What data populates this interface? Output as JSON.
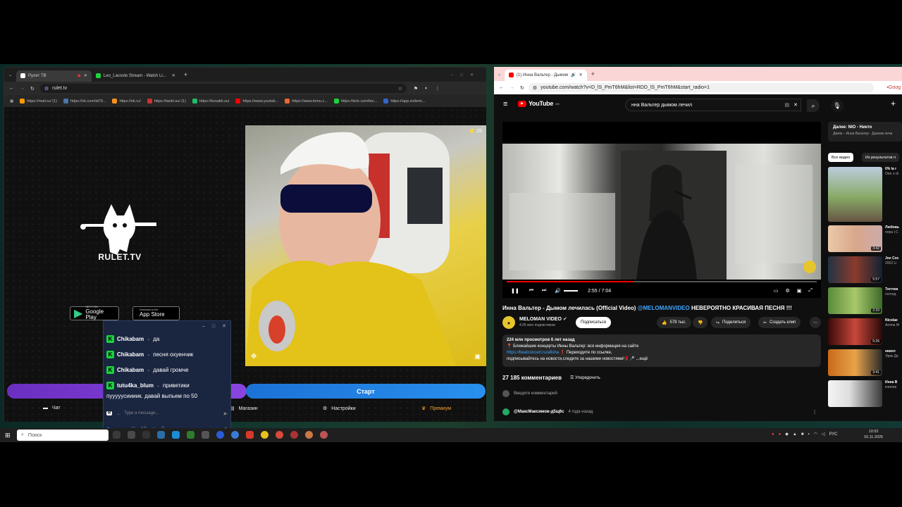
{
  "left_browser": {
    "tabs": [
      {
        "title": "Рулет ТВ",
        "active": true
      },
      {
        "title": "Leo_Lacoste Stream - Watch Li...",
        "active": false
      }
    ],
    "address": "rulet.tv",
    "bookmarks": [
      "https://mail.ru/ (1)",
      "https://vk.com/id79...",
      "https://ok.ru/",
      "https://tanki.su/ (1)",
      "https://kosabli.su/",
      "https://www.youtub...",
      "https://www.tmnu.c...",
      "https://kick.com/leo...",
      "https://app.snilemi..."
    ]
  },
  "rulet": {
    "brand": "RULET.TV",
    "google_play_small": "GET IT ON",
    "google_play": "Google Play",
    "app_store_small": "Download on the",
    "app_store": "App Store",
    "stars": "25",
    "start_button": "Старт",
    "nav": [
      "Чат",
      "Магазин",
      "Настройки",
      "Премиум"
    ]
  },
  "chat": {
    "messages": [
      {
        "user": "Chikabam",
        "text": "да"
      },
      {
        "user": "Chikabam",
        "text": "песня охуенчик"
      },
      {
        "user": "Chikabam",
        "text": "давай громче"
      },
      {
        "user": "tutu4ka_blum",
        "text": "приветики"
      }
    ],
    "extra_line": "пууууусиииик. давай выпьем по 50",
    "placeholder": "Type a message...",
    "viewers": "1/1",
    "eye_count": "0"
  },
  "right_browser": {
    "tab_title": "(1) Инна Вальтер - Дымом",
    "address": "youtube.com/watch?v=D_lS_PmT6hM&list=RDD_lS_PmT6hM&start_radio=1",
    "bookmark_right": "Goog"
  },
  "youtube": {
    "logo": "YouTube",
    "region": "MD",
    "search_query": "нна Вальтер дымом лечил",
    "video_title_plain": "Инна Вальтер - Дымом лечилась (Official Video) ",
    "video_title_link": "@MELOMANVIDEO",
    "video_title_tail": " НЕВЕРОЯТНО КРАСИВАЯ ПЕСНЯ !!!",
    "time": "2:55 / 7:04",
    "progress_fraction": 0.41,
    "channel": "MELOMAN VIDEO",
    "subscribers": "4,05 млн подписчиков",
    "subscribe": "Подписаться",
    "likes": "578 тыс.",
    "share": "Поделиться",
    "clip": "Создать клип",
    "desc_stats": "224 млн просмотров  6 лет назад",
    "desc_line1": "📍 Ближайшие концерты Инны Вальтер: вся информация на сайте",
    "desc_link": "https://beatconcert.ru/afisha",
    "desc_line2": "❗ Переходите по ссылке,",
    "desc_line3": "подписывайтесь на новости,следите за нашими новостями!🌹🎤 ...ещё",
    "comments_count": "27 185 комментариев",
    "sort": "Упорядочить",
    "add_comment": "Введите комментарий",
    "first_comment_author": "@МаксМаксимов-д5щ6с",
    "first_comment_time": "4 года назад",
    "next_up": "Далее: NIO - Никто",
    "next_up_sub": "Джем – Инна Вальтер - Дымом лечи",
    "chips": [
      "Все видео",
      "Из результатов п"
    ],
    "sidebar": [
      {
        "title": "0% la r",
        "sub": "Oee o di",
        "dur": ""
      },
      {
        "title": "Любовь",
        "sub": "пора | С",
        "dur": "3:42"
      },
      {
        "title": "Joe Coc",
        "sub": "2002 Li",
        "dur": "5:57"
      },
      {
        "title": "Тютчев",
        "sub": "господ",
        "dur": "2:33"
      },
      {
        "title": "Nicolae",
        "sub": "Amma M",
        "dur": "5:26"
      },
      {
        "title": "никол",
        "sub": "Эрик Де",
        "dur": "3:41"
      },
      {
        "title": "Инна В",
        "sub": "клипов",
        "dur": ""
      }
    ]
  },
  "taskbar": {
    "search": "Поиск",
    "lang": "РУС",
    "time": "10:52",
    "date": "16.11.2025"
  }
}
